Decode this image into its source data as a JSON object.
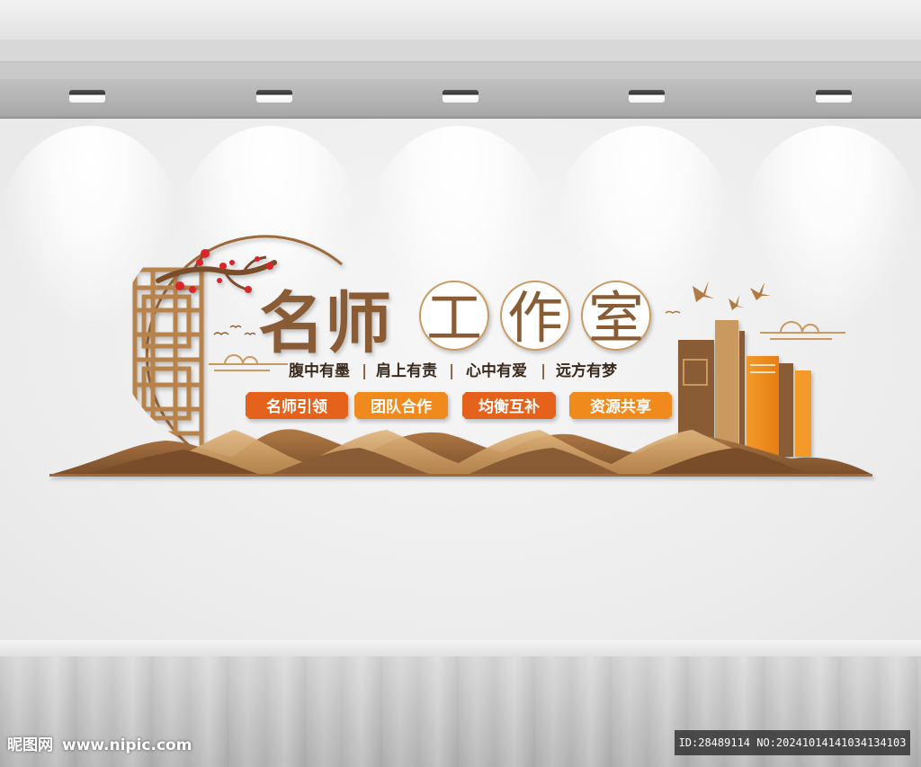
{
  "title": {
    "part1": "名师",
    "chars": [
      "工",
      "作",
      "室"
    ]
  },
  "slogan": [
    "腹中有墨",
    "肩上有责",
    "心中有爱",
    "远方有梦"
  ],
  "slogan_separator": "|",
  "tags": [
    {
      "label": "名师引领",
      "color": "#e5621e"
    },
    {
      "label": "团队合作",
      "color": "#f08a1f"
    },
    {
      "label": "均衡互补",
      "color": "#e5621e"
    },
    {
      "label": "资源共享",
      "color": "#f08a1f"
    }
  ],
  "colors": {
    "brown": "#8a5b34",
    "tan": "#c9995f",
    "orange": "#f08a1f",
    "red": "#d8262b"
  },
  "watermark": {
    "site_name": "昵图网",
    "site_url": "www.nipic.com",
    "id_text": "ID:28489114 NO:20241014141034134103"
  }
}
